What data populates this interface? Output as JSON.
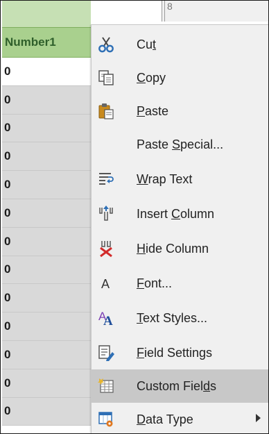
{
  "sheet": {
    "column_header": "Number1",
    "next_column_label": "8",
    "cell_values": [
      "0",
      "0",
      "0",
      "0",
      "0",
      "0",
      "0",
      "0",
      "0",
      "0",
      "0",
      "0",
      "0"
    ]
  },
  "menu": {
    "items": [
      {
        "id": "cut",
        "label": "Cut",
        "icon": "scissors-icon"
      },
      {
        "id": "copy",
        "label": "Copy",
        "icon": "copy-icon"
      },
      {
        "id": "paste",
        "label": "Paste",
        "icon": "paste-icon"
      },
      {
        "id": "paste-special",
        "label": "Paste Special...",
        "icon": ""
      },
      {
        "id": "wrap-text",
        "label": "Wrap Text",
        "icon": "wrap-text-icon"
      },
      {
        "id": "insert-column",
        "label": "Insert Column",
        "icon": "insert-column-icon"
      },
      {
        "id": "hide-column",
        "label": "Hide Column",
        "icon": "hide-column-icon"
      },
      {
        "id": "font",
        "label": "Font...",
        "icon": "font-icon"
      },
      {
        "id": "text-styles",
        "label": "Text Styles...",
        "icon": "text-styles-icon"
      },
      {
        "id": "field-settings",
        "label": "Field Settings",
        "icon": "field-settings-icon"
      },
      {
        "id": "custom-fields",
        "label": "Custom Fields",
        "icon": "custom-fields-icon",
        "highlighted": true
      },
      {
        "id": "data-type",
        "label": "Data Type",
        "icon": "data-type-icon",
        "submenu": true
      }
    ]
  },
  "colors": {
    "header_green": "#a9d08e",
    "menu_bg": "#f0f0f0",
    "menu_highlight": "#c8c8c8",
    "cut_blue": "#2e6fb5",
    "hide_red": "#d22b2b",
    "paste_orange": "#c88a1e"
  }
}
